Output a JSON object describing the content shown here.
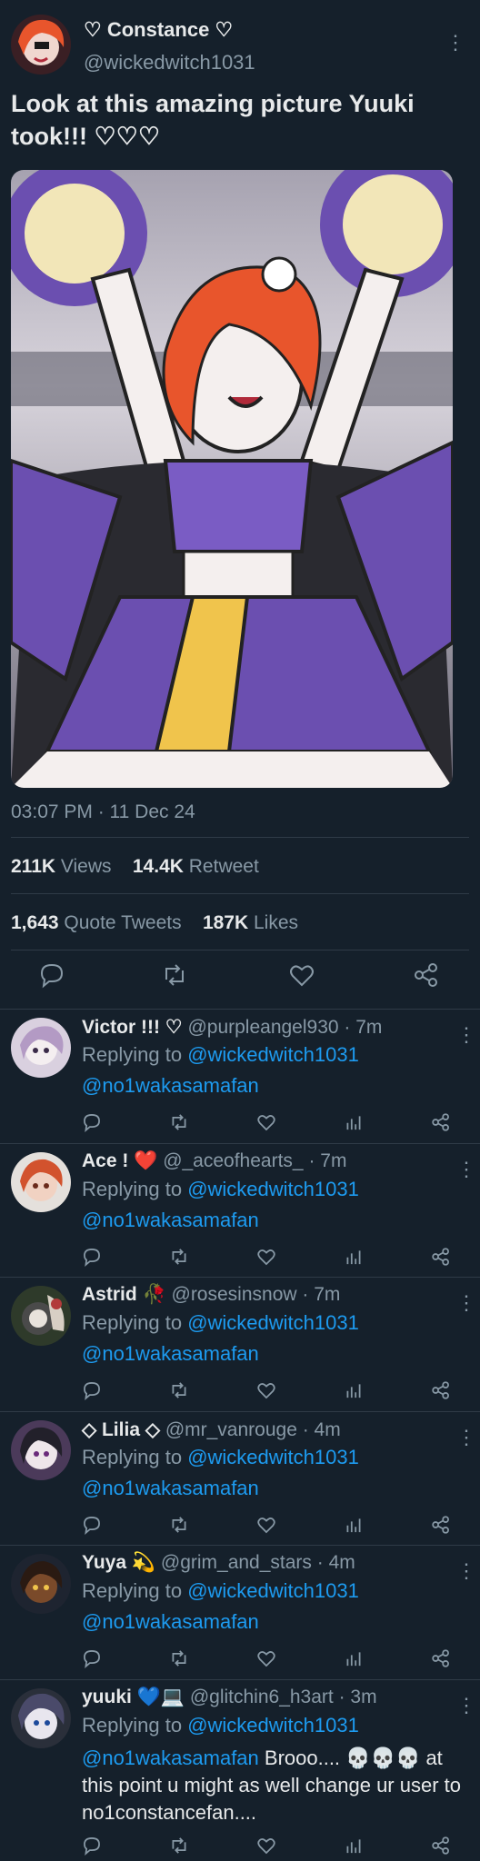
{
  "post": {
    "author_name": "♡ Constance ♡",
    "handle": "@wickedwitch1031",
    "text": "Look at this amazing picture Yuuki took!!! ♡♡♡",
    "timestamp": "03:07 PM · 11 Dec 24",
    "stats": {
      "views_count": "211K",
      "views_label": "Views",
      "retweets_count": "14.4K",
      "retweets_label": "Retweet",
      "quotes_count": "1,643",
      "quotes_label": "Quote Tweets",
      "likes_count": "187K",
      "likes_label": "Likes"
    }
  },
  "replies": [
    {
      "name": "Victor !!! ♡",
      "handle": "@purpleangel930",
      "time": "· 7m",
      "replying_label": "Replying to",
      "replying_handle": "@wickedwitch1031",
      "mention": "@no1wakasamafan",
      "text": ""
    },
    {
      "name": "Ace ! ❤️",
      "handle": "@_aceofhearts_",
      "time": "· 7m",
      "replying_label": "Replying to",
      "replying_handle": "@wickedwitch1031",
      "mention": "@no1wakasamafan",
      "text": ""
    },
    {
      "name": "Astrid 🥀",
      "handle": "@rosesinsnow",
      "time": "· 7m",
      "replying_label": "Replying to",
      "replying_handle": "@wickedwitch1031",
      "mention": "@no1wakasamafan",
      "text": ""
    },
    {
      "name": "◇ Lilia ◇",
      "handle": "@mr_vanrouge",
      "time": "· 4m",
      "replying_label": "Replying to",
      "replying_handle": "@wickedwitch1031",
      "mention": "@no1wakasamafan",
      "text": ""
    },
    {
      "name": "Yuya 💫",
      "handle": "@grim_and_stars",
      "time": "· 4m",
      "replying_label": "Replying to",
      "replying_handle": "@wickedwitch1031",
      "mention": "@no1wakasamafan",
      "text": ""
    },
    {
      "name": "yuuki 💙💻",
      "handle": "@glitchin6_h3art",
      "time": "· 3m",
      "replying_label": "Replying to",
      "replying_handle": "@wickedwitch1031",
      "mention": "@no1wakasamafan",
      "text": " Brooo.... 💀💀💀 at this point u might as well change ur user to no1constancefan...."
    }
  ],
  "colors": {
    "background": "#15202b",
    "link": "#1d9bf0",
    "muted": "#8899a6",
    "divider": "#2f3b47"
  },
  "icons": [
    "kebab-icon",
    "reply-icon",
    "retweet-icon",
    "like-icon",
    "share-icon",
    "analytics-icon"
  ]
}
